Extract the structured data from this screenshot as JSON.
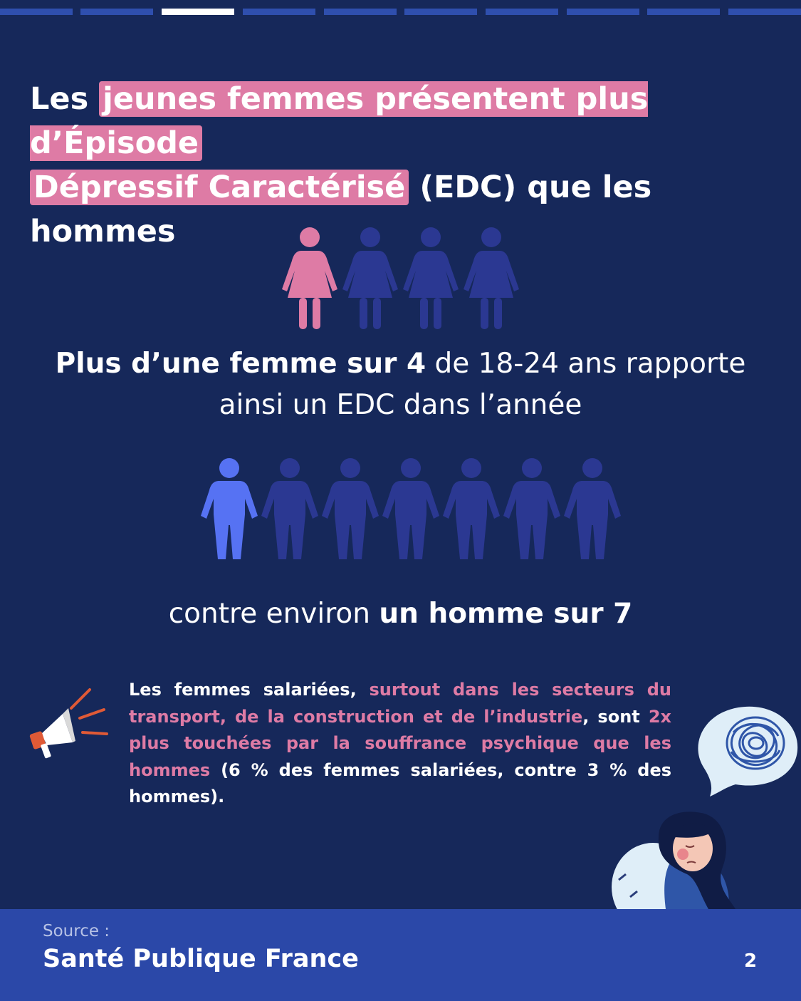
{
  "progress": {
    "segments": 10,
    "active_index": 2
  },
  "title": {
    "pre": "Les",
    "highlight_1": "jeunes femmes présentent plus d’Épisode",
    "highlight_2": "Dépressif Caractérisé",
    "post": "(EDC) que les hommes"
  },
  "women_figures": {
    "total": 4,
    "highlighted": 1,
    "highlight_color": "#de7ba5",
    "base_color": "#2b3892"
  },
  "stat_women": {
    "bold": "Plus d’une femme sur 4",
    "rest_1": " de 18-24 ans rapporte",
    "rest_2": "ainsi un EDC dans l’année"
  },
  "men_figures": {
    "total": 7,
    "highlighted": 1,
    "highlight_color": "#5672f3",
    "base_color": "#2b3892"
  },
  "stat_men": {
    "normal": "contre environ ",
    "bold": "un homme sur 7"
  },
  "body": {
    "p1": "Les femmes salariées, ",
    "p2": "surtout dans les secteurs du transport, de la construction et de l’industrie",
    "p3": ", sont ",
    "p4": "2x plus touchées par la souffrance psychique que les hommes",
    "p5": " (6 % des femmes salariées, contre 3 % des hommes)."
  },
  "icons": {
    "megaphone": "megaphone-icon",
    "thought_bubble": "thought-bubble-icon",
    "woman": "sad-woman-illustration"
  },
  "footer": {
    "source_label": "Source :",
    "source_name": "Santé Publique France",
    "page_number": "2"
  },
  "colors": {
    "background": "#16285a",
    "footer": "#2b48a8",
    "accent_pink": "#de7ba5",
    "accent_blue": "#5672f3"
  }
}
